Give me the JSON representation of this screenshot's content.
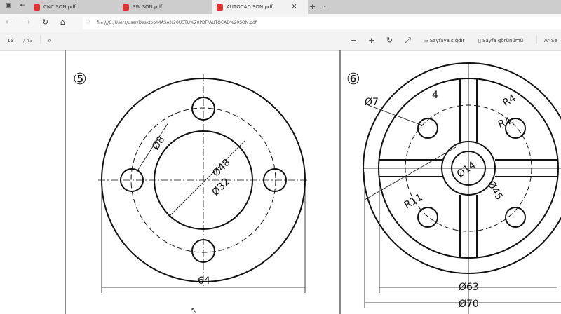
{
  "tabs": [
    {
      "label": "CNC SON.pdf"
    },
    {
      "label": "SW SON.pdf"
    },
    {
      "label": "AUTOCAD SON.pdf",
      "active": true
    }
  ],
  "address": {
    "url": "file:///C:/Users/user/Desktop/MASA%20ÜSTÜ%20PDF/AUTOCAD%20SON.pdf"
  },
  "toolbar": {
    "page": "15",
    "total": "/ 43",
    "fit_page": "Sayfaya sığdır",
    "page_view": "Sayfa görünümü",
    "read_aloud": "Se"
  },
  "drawing5": {
    "number": "⑤",
    "d8": "Ø8",
    "d48": "Ø48",
    "d32": "Ø32",
    "w": "64"
  },
  "drawing6": {
    "number": "⑥",
    "d7": "Ø7",
    "w4": "4",
    "r4a": "R4",
    "r4b": "R4",
    "d14": "Ø14",
    "r11": "R11",
    "d45": "Ø45",
    "d63": "Ø63",
    "d70": "Ø70"
  }
}
